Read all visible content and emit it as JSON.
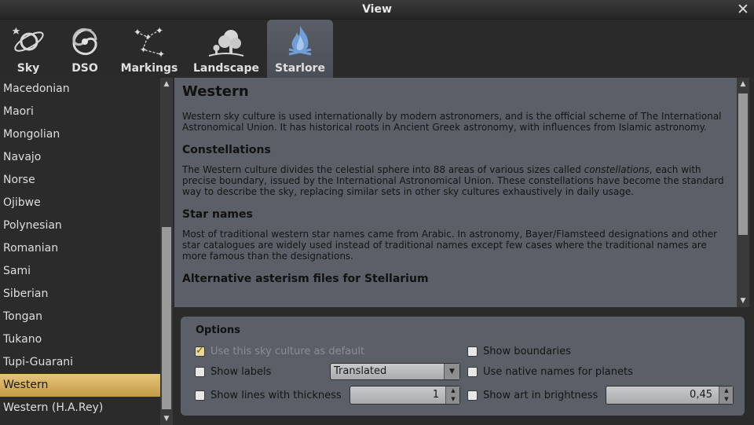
{
  "window": {
    "title": "View",
    "close_glyph": "✕"
  },
  "tabs": [
    {
      "label": "Sky",
      "icon": "sky-icon"
    },
    {
      "label": "DSO",
      "icon": "galaxy-icon"
    },
    {
      "label": "Markings",
      "icon": "constellation-icon"
    },
    {
      "label": "Landscape",
      "icon": "tree-icon"
    },
    {
      "label": "Starlore",
      "icon": "campfire-icon",
      "active": true
    }
  ],
  "sky_cultures": [
    "Macedonian",
    "Maori",
    "Mongolian",
    "Navajo",
    "Norse",
    "Ojibwe",
    "Polynesian",
    "Romanian",
    "Sami",
    "Siberian",
    "Tongan",
    "Tukano",
    "Tupi-Guarani",
    "Western",
    "Western (H.A.Rey)"
  ],
  "selected_culture": "Western",
  "info": {
    "title": "Western",
    "intro": "Western sky culture is used internationally by modern astronomers, and is the official scheme of The International Astronomical Union. It has historical roots in Ancient Greek astronomy, with influences from Islamic astronomy.",
    "constellations_heading": "Constellations",
    "constellations_text_pre": "The Western culture divides the celestial sphere into 88 areas of various sizes called ",
    "constellations_text_em": "constellations",
    "constellations_text_post": ", each with precise boundary, issued by the International Astronomical Union. These constellations have become the standard way to describe the sky, replacing similar sets in other sky cultures exhaustively in daily usage.",
    "starnames_heading": "Star names",
    "starnames_text": "Most of traditional western star names came from Arabic. In astronomy, Bayer/Flamsteed designations and other star catalogues are widely used instead of traditional names except few cases where the traditional names are more famous than the designations.",
    "asterism_heading": "Alternative asterism files for Stellarium"
  },
  "options": {
    "title": "Options",
    "use_default_label": "Use this sky culture as default",
    "use_default_checked": true,
    "show_boundaries_label": "Show boundaries",
    "show_labels_label": "Show labels",
    "labels_mode": "Translated",
    "native_names_label": "Use native names for planets",
    "show_lines_label": "Show lines with thickness",
    "lines_thickness": "1",
    "show_art_label": "Show art in brightness",
    "art_brightness": "0,45"
  },
  "colors": {
    "accent": "#d4ad5c",
    "panel": "#5b5f67",
    "background": "#2b2b2b"
  }
}
